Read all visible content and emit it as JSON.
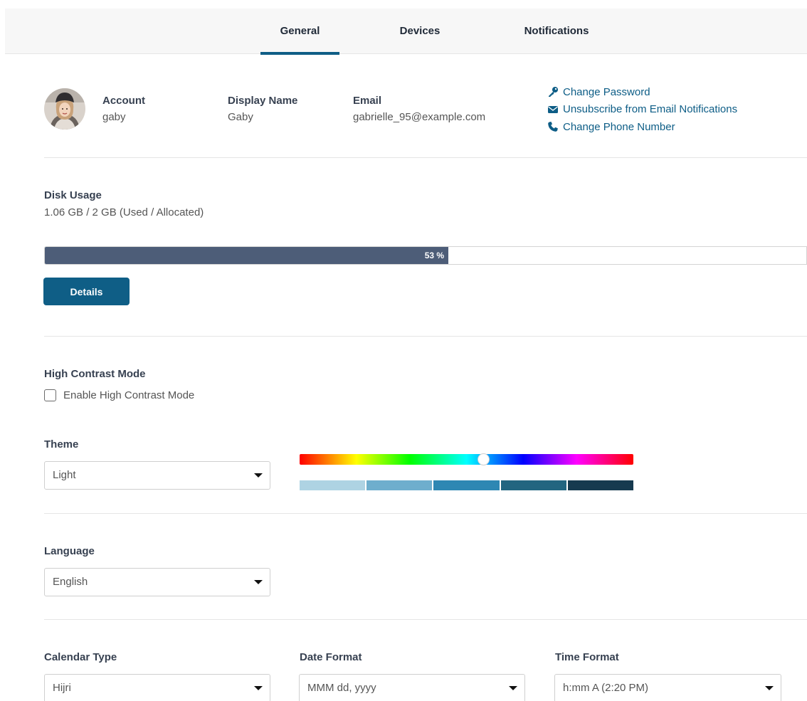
{
  "tabs": [
    {
      "label": "General",
      "active": true
    },
    {
      "label": "Devices",
      "active": false
    },
    {
      "label": "Notifications",
      "active": false
    }
  ],
  "profile": {
    "account_label": "Account",
    "account_value": "gaby",
    "display_name_label": "Display Name",
    "display_name_value": "Gaby",
    "email_label": "Email",
    "email_value": "gabrielle_95@example.com"
  },
  "links": {
    "change_password": {
      "label": "Change Password",
      "icon": "key-icon"
    },
    "unsubscribe": {
      "label": "Unsubscribe from Email Notifications",
      "icon": "envelope-icon"
    },
    "change_phone": {
      "label": "Change Phone Number",
      "icon": "phone-icon"
    }
  },
  "disk": {
    "title": "Disk Usage",
    "usage_text": "1.06 GB / 2 GB (Used / Allocated)",
    "percent": 53,
    "percent_text": "53 %",
    "details_button": "Details"
  },
  "contrast": {
    "title": "High Contrast Mode",
    "checkbox_label": "Enable High Contrast Mode",
    "checked": false
  },
  "theme": {
    "title": "Theme",
    "selected": "Light",
    "hue_position": 0.55,
    "swatches": [
      "#aed3e3",
      "#6eaecd",
      "#2e87b3",
      "#226580",
      "#163a4f"
    ]
  },
  "language": {
    "title": "Language",
    "selected": "English"
  },
  "calendar": {
    "title": "Calendar Type",
    "selected": "Hijri"
  },
  "date_format": {
    "title": "Date Format",
    "selected": "MMM dd, yyyy"
  },
  "time_format": {
    "title": "Time Format",
    "selected": "h:mm A (2:20 PM)"
  },
  "colors": {
    "accent": "#0f5e86",
    "progress_fill": "#4d5d78",
    "link": "#0d5d86"
  }
}
